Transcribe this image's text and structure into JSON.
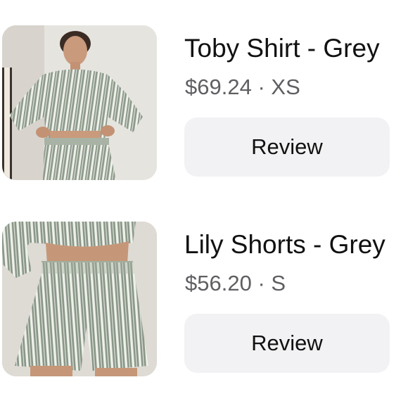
{
  "items": [
    {
      "title": "Toby Shirt - Grey",
      "price": "$69.24",
      "separator": "·",
      "size": "XS",
      "review_label": "Review",
      "image": "model-wearing-grey-striped-shirt"
    },
    {
      "title": "Lily Shorts - Grey",
      "price": "$56.20",
      "separator": "·",
      "size": "S",
      "review_label": "Review",
      "image": "model-wearing-grey-striped-shorts"
    }
  ],
  "colors": {
    "title_text": "#111111",
    "meta_text": "#5f5f63",
    "button_bg": "#f2f2f4",
    "fabric": "#8e9a8c",
    "stripe": "#eef0ea"
  }
}
